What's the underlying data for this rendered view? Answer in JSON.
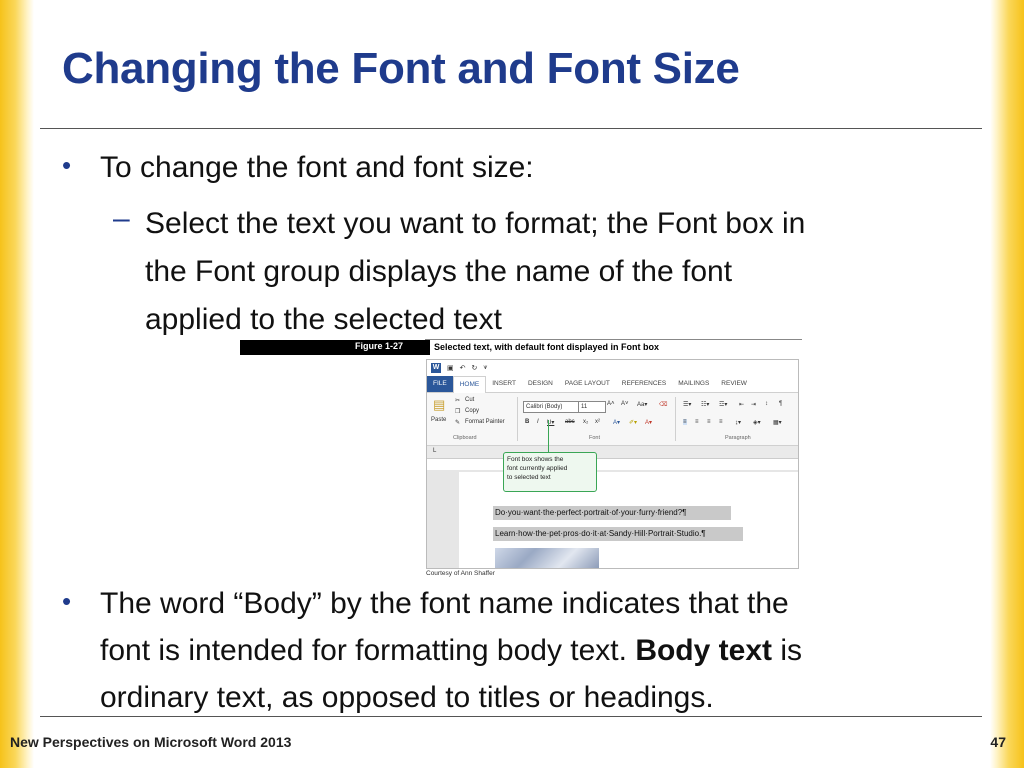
{
  "title": "Changing the Font and Font Size",
  "bullets": {
    "b1": "To change the font and font size:",
    "sub1_line1": "Select the text you want to format; the Font box in",
    "sub1_line2": "the Font group displays the name of the font",
    "sub1_line3": "applied to the selected text",
    "b2_line1": "The word “Body” by the font name indicates that the",
    "b2_line2_a": "font is intended for formatting body text. ",
    "b2_line2_bold": "Body text",
    "b2_line2_b": " is",
    "b2_line3": "ordinary text, as opposed to titles or headings."
  },
  "figure": {
    "label": "Figure 1-27",
    "caption": "Selected text, with default font displayed in Font box",
    "credit": "Courtesy of Ann Shaffer",
    "tabs": [
      "FILE",
      "HOME",
      "INSERT",
      "DESIGN",
      "PAGE LAYOUT",
      "REFERENCES",
      "MAILINGS",
      "REVIEW"
    ],
    "clipboard": {
      "paste": "Paste",
      "cut": "Cut",
      "copy": "Copy",
      "format_painter": "Format Painter",
      "group": "Clipboard"
    },
    "font_box_value": "Calibri (Body)",
    "font_size_value": "11",
    "font_group": "Font",
    "paragraph_group": "Paragraph",
    "callout": {
      "l1": "Font box shows the",
      "l2": "font currently applied",
      "l3": "to selected text"
    },
    "doc_line1": "Do·you·want·the·perfect·portrait·of·your·furry·friend?¶",
    "doc_line2": "Learn·how·the·pet·pros·do·it·at·Sandy·Hill·Portrait·Studio.¶"
  },
  "footer": {
    "left": "New Perspectives on Microsoft Word 2013",
    "page": "47"
  },
  "colors": {
    "title": "#1f3b8c",
    "accent_edge": "#f6c21a",
    "word_blue": "#2b579a",
    "callout_green": "#3aa655"
  }
}
